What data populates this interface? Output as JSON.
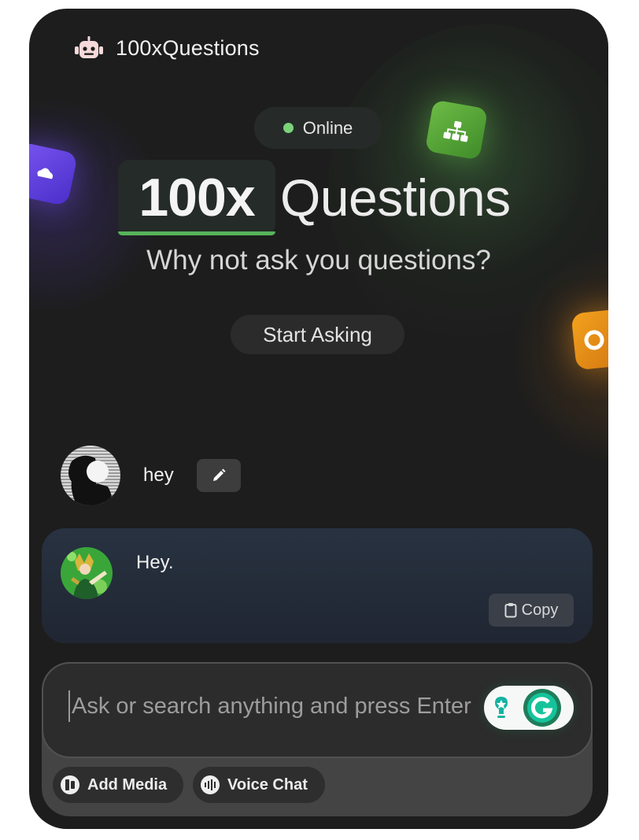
{
  "header": {
    "brand_icon": "robot-icon",
    "brand_name": "100xQuestions"
  },
  "status": {
    "label": "Online",
    "color": "#7ad37a"
  },
  "hero": {
    "title_bold": "100x",
    "title_rest": "Questions",
    "subtitle": "Why not ask you questions?",
    "cta_label": "Start Asking",
    "accent_color": "#57b35a"
  },
  "decorations": [
    "green-sitemap-icon",
    "purple-app-icon",
    "orange-app-icon"
  ],
  "messages": [
    {
      "role": "user",
      "text": "hey",
      "action_icon": "pencil-icon"
    },
    {
      "role": "assistant",
      "text": "Hey.",
      "action_label": "Copy",
      "action_icon": "clipboard-icon"
    }
  ],
  "composer": {
    "placeholder": "Ask or search anything and press Enter",
    "buttons": [
      {
        "label": "Add Media",
        "icon": "media-icon"
      },
      {
        "label": "Voice Chat",
        "icon": "voice-icon"
      }
    ],
    "extension_icon": "grammarly-icon"
  }
}
